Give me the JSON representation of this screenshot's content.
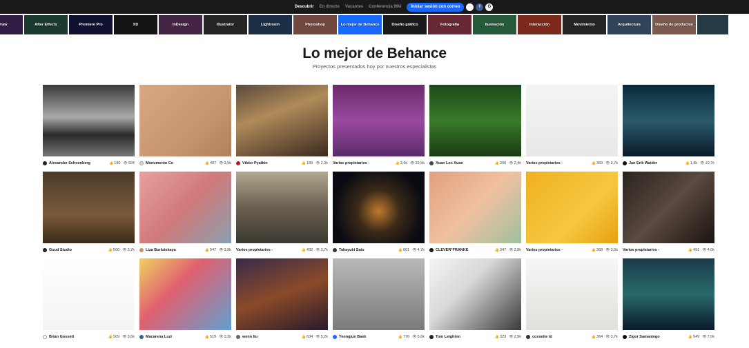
{
  "topnav": {
    "links": [
      "Descubrir",
      "En directo",
      "Vacantes",
      "Conferencia 99U"
    ],
    "login_label": "Iniciar sesión con correo",
    "social": [
      {
        "icon": "apple-icon",
        "glyph": ""
      },
      {
        "icon": "facebook-icon",
        "glyph": "f"
      },
      {
        "icon": "google-icon",
        "glyph": "G"
      }
    ]
  },
  "categories": [
    {
      "label": "Corel Draw",
      "visible_label": "e Draw",
      "color": "#4a2a6a"
    },
    {
      "label": "After Effects",
      "color": "#2a5a4a"
    },
    {
      "label": "Premiere Pro",
      "color": "#1a1a4a"
    },
    {
      "label": "XD",
      "color": "#202020"
    },
    {
      "label": "InDesign",
      "color": "#6a3a6a"
    },
    {
      "label": "Illustrator",
      "color": "#3a3a3a"
    },
    {
      "label": "Lightroom",
      "color": "#2a4a6a"
    },
    {
      "label": "Photoshop",
      "color": "#b07060"
    },
    {
      "label": "Lo mejor de Behance",
      "color": "#1769ff"
    },
    {
      "label": "Diseño gráfico",
      "color": "#2a2a2a"
    },
    {
      "label": "Fotografía",
      "color": "#a04050"
    },
    {
      "label": "Ilustración",
      "color": "#3a8a5a"
    },
    {
      "label": "Interacción",
      "color": "#c0402a"
    },
    {
      "label": "Movimiento",
      "color": "#3a3a3a"
    },
    {
      "label": "Arquitectura",
      "color": "#4a6a8a"
    },
    {
      "label": "Diseño de productos",
      "color": "#c08a7a"
    },
    {
      "label": "",
      "color": "#3a5a6a"
    }
  ],
  "heading": {
    "title": "Lo mejor de Behance",
    "subtitle": "Proyectos presentados hoy por nuestros especialistas"
  },
  "projects": [
    {
      "owner": "Alexander Schoenberg",
      "likes": "180",
      "views": "594",
      "bg": "linear-gradient(180deg,#3a3a3a 0%,#aaaaaa 45%,#2a2a2a 70%,#777 100%)",
      "ava": "#222"
    },
    {
      "owner": "Monumento Co",
      "likes": "407",
      "views": "2,5k",
      "bg": "linear-gradient(135deg,#d8a884 0%,#c79570 60%,#b3805c 100%)",
      "ava": "#ddd"
    },
    {
      "owner": "Viktor Pyatkin",
      "likes": "189",
      "views": "2,3k",
      "bg": "linear-gradient(160deg,#5a4a3a 0%,#b08a5a 40%,#3a2a20 100%)",
      "ava": "#b02020"
    },
    {
      "owner": "Varios propietarios -",
      "likes": "3,6k",
      "views": "33,5k",
      "bg": "linear-gradient(180deg,#6a2a6a 0%,#9a4aa0 50%,#5a2a6a 100%)",
      "ava": ""
    },
    {
      "owner": "Xuan Loc Xuan",
      "likes": "266",
      "views": "2,4k",
      "bg": "linear-gradient(180deg,#1a4a1a 0%,#3a7a2a 50%,#1a3a14 100%)",
      "ava": "#444"
    },
    {
      "owner": "Varios propietarios -",
      "likes": "369",
      "views": "3,7k",
      "bg": "linear-gradient(180deg,#f4f4f2 0%,#e8e8e6 100%)",
      "ava": ""
    },
    {
      "owner": "Jan Erik Waider",
      "likes": "1,8k",
      "views": "10,7k",
      "bg": "linear-gradient(180deg,#0a2a3a 0%,#2a5a6a 50%,#0a1a2a 100%)",
      "ava": "#111"
    },
    {
      "owner": "Guud Studio",
      "likes": "500",
      "views": "3,7k",
      "bg": "linear-gradient(180deg,#4a3a2a 0%,#7a5a3a 60%,#3a2a1a 100%)",
      "ava": "#222"
    },
    {
      "owner": "Liza Burlutskaya",
      "likes": "547",
      "views": "3,9k",
      "bg": "linear-gradient(135deg,#e8a0a0 0%,#d07a7a 50%,#8aa0b0 100%)",
      "ava": "#c89060"
    },
    {
      "owner": "Varios propietarios -",
      "likes": "432",
      "views": "3,7k",
      "bg": "linear-gradient(180deg,#b0a890 0%,#6a6050 50%,#3a3a30 100%)",
      "ava": ""
    },
    {
      "owner": "Takayuki Sato",
      "likes": "601",
      "views": "4,7k",
      "bg": "radial-gradient(circle at 50% 55%,#c07a2a 0%,#3a2a1a 35%,#0a0a12 75%)",
      "ava": "#333"
    },
    {
      "owner": "CLEVER°FRANKE",
      "likes": "347",
      "views": "2,8k",
      "bg": "linear-gradient(135deg,#e0a080 0%,#f0c0a0 50%,#a0c0a0 100%)",
      "ava": "#111"
    },
    {
      "owner": "Varios propietarios -",
      "likes": "368",
      "views": "3,5k",
      "bg": "linear-gradient(135deg,#f0b020 0%,#f6c840 60%,#e8a010 100%)",
      "ava": ""
    },
    {
      "owner": "Varios propietarios -",
      "likes": "491",
      "views": "4,0k",
      "bg": "linear-gradient(135deg,#2a2420 0%,#5a4a40 50%,#1a1410 100%)",
      "ava": ""
    },
    {
      "owner": "Brian Gossett",
      "likes": "509",
      "views": "3,6k",
      "bg": "linear-gradient(180deg,#ffffff 0%,#f4f4f4 100%)",
      "ava": "#fff"
    },
    {
      "owner": "Macarena Luzi",
      "likes": "519",
      "views": "3,3k",
      "bg": "linear-gradient(135deg,#f0d060 0%,#e06070 40%,#60a0d0 100%)",
      "ava": "#3a5a9a"
    },
    {
      "owner": "wenn liu",
      "likes": "634",
      "views": "5,2k",
      "bg": "linear-gradient(160deg,#3a2a4a 0%,#8a4a2a 50%,#2a1a2a 100%)",
      "ava": "#666"
    },
    {
      "owner": "Yeongjun Baek",
      "likes": "776",
      "views": "5,6k",
      "bg": "linear-gradient(180deg,#b8b8b8 0%,#9a9a9a 50%,#7a7a7a 100%)",
      "ava": "#1769ff"
    },
    {
      "owner": "Tom Leighton",
      "likes": "323",
      "views": "2,9k",
      "bg": "linear-gradient(135deg,#f4f4f4 0%,#d8d8d8 40%,#3a3a3a 100%)",
      "ava": "#222"
    },
    {
      "owner": "coxsette id",
      "likes": "364",
      "views": "3,7k",
      "bg": "linear-gradient(180deg,#f6f6f4 0%,#e0e0dc 100%)",
      "ava": "#333"
    },
    {
      "owner": "Zigor Samaniego",
      "likes": "949",
      "views": "7,0k",
      "bg": "linear-gradient(180deg,#1a3a4a 0%,#2a6a6a 50%,#0a1a2a 100%)",
      "ava": "#111"
    }
  ]
}
